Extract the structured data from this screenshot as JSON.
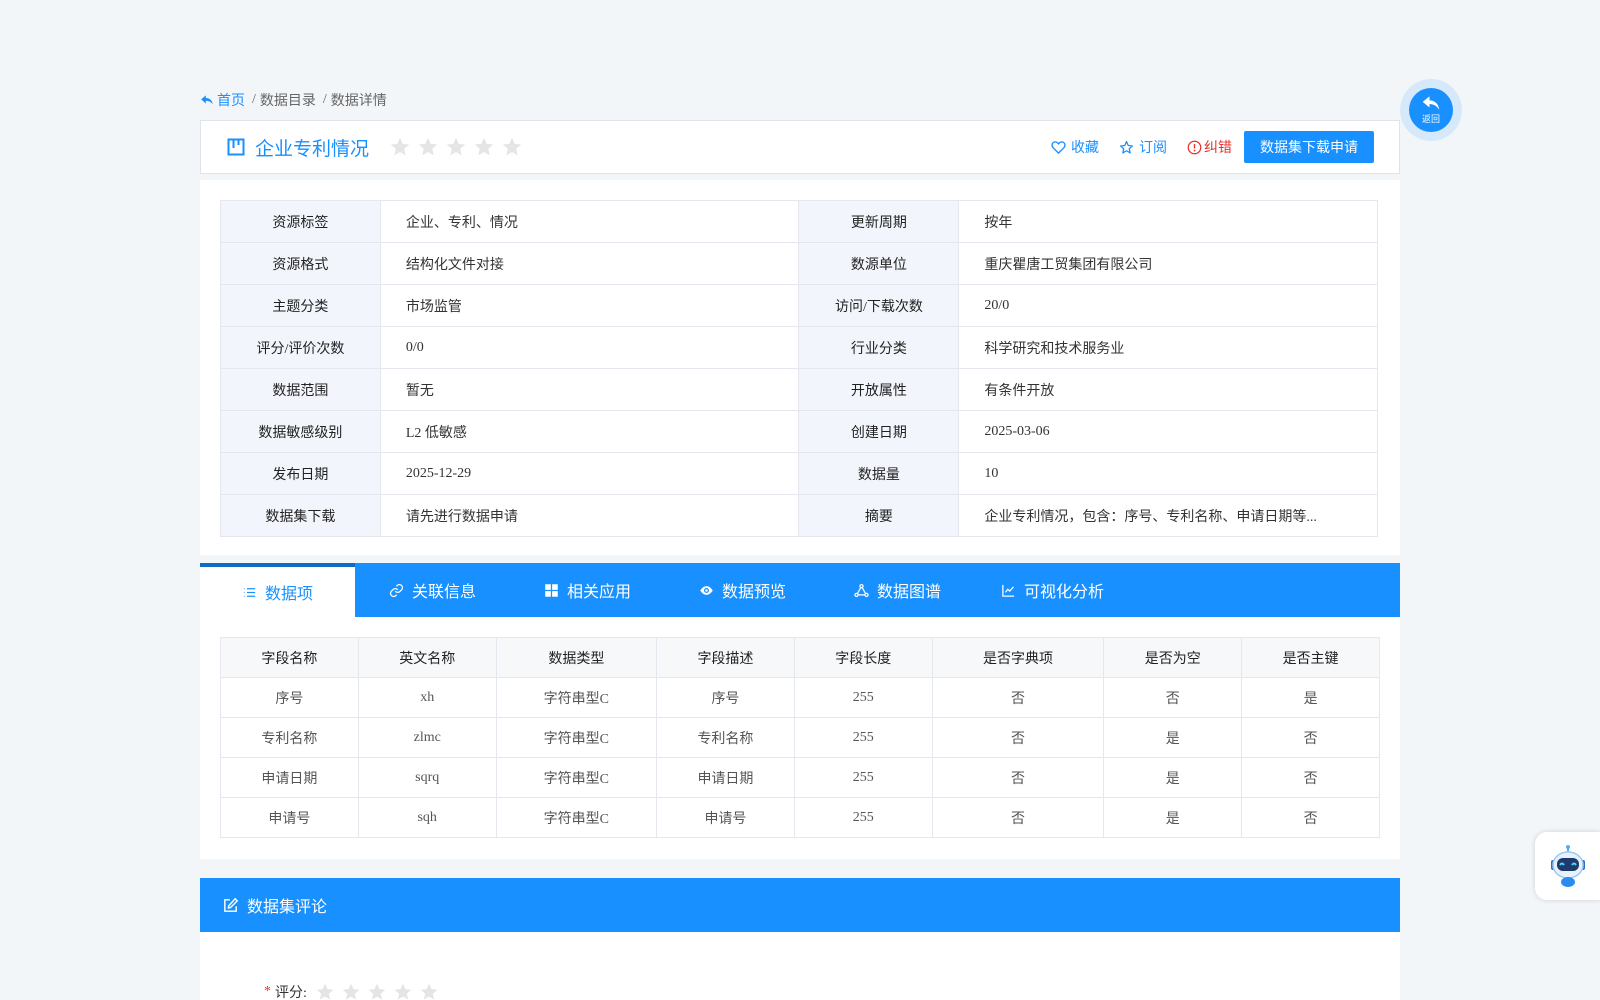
{
  "breadcrumb": {
    "home": "首页",
    "items": [
      "数据目录",
      "数据详情"
    ]
  },
  "title": {
    "name": "企业专利情况",
    "rating_stars": 0,
    "actions": {
      "favorite": "收藏",
      "subscribe": "订阅",
      "report_error": "纠错",
      "apply_button": "数据集下载申请"
    }
  },
  "info": {
    "rows": [
      {
        "l1": "资源标签",
        "v1": "企业、专利、情况",
        "l2": "更新周期",
        "v2": "按年"
      },
      {
        "l1": "资源格式",
        "v1": "结构化文件对接",
        "l2": "数源单位",
        "v2": "重庆瞿唐工贸集团有限公司"
      },
      {
        "l1": "主题分类",
        "v1": "市场监管",
        "l2": "访问/下载次数",
        "v2": "20/0"
      },
      {
        "l1": "评分/评价次数",
        "v1": "0/0",
        "l2": "行业分类",
        "v2": "科学研究和技术服务业"
      },
      {
        "l1": "数据范围",
        "v1": "暂无",
        "l2": "开放属性",
        "v2": "有条件开放"
      },
      {
        "l1": "数据敏感级别",
        "v1": "L2 低敏感",
        "l2": "创建日期",
        "v2": "2025-03-06"
      },
      {
        "l1": "发布日期",
        "v1": "2025-12-29",
        "l2": "数据量",
        "v2": "10"
      },
      {
        "l1": "数据集下载",
        "v1": "请先进行数据申请",
        "l2": "摘要",
        "v2": "企业专利情况，包含：序号、专利名称、申请日期等..."
      }
    ]
  },
  "tabs": {
    "items": [
      {
        "label": "数据项",
        "icon": "list-icon"
      },
      {
        "label": "关联信息",
        "icon": "link-icon"
      },
      {
        "label": "相关应用",
        "icon": "grid-icon"
      },
      {
        "label": "数据预览",
        "icon": "eye-icon"
      },
      {
        "label": "数据图谱",
        "icon": "graph-icon"
      },
      {
        "label": "可视化分析",
        "icon": "line-chart-icon"
      }
    ],
    "active_index": 0
  },
  "fields": {
    "headers": [
      "字段名称",
      "英文名称",
      "数据类型",
      "字段描述",
      "字段长度",
      "是否字典项",
      "是否为空",
      "是否主键"
    ],
    "rows": [
      [
        "序号",
        "xh",
        "字符串型C",
        "序号",
        "255",
        "否",
        "否",
        "是"
      ],
      [
        "专利名称",
        "zlmc",
        "字符串型C",
        "专利名称",
        "255",
        "否",
        "是",
        "否"
      ],
      [
        "申请日期",
        "sqrq",
        "字符串型C",
        "申请日期",
        "255",
        "否",
        "是",
        "否"
      ],
      [
        "申请号",
        "sqh",
        "字符串型C",
        "申请号",
        "255",
        "否",
        "是",
        "否"
      ]
    ]
  },
  "comments": {
    "title": "数据集评论",
    "required_mark": "*",
    "rating_label": "评分:"
  },
  "floating": {
    "back_label": "返回"
  },
  "colors": {
    "primary": "#1890ff",
    "danger": "#e8322b",
    "star_empty": "#e5e5e5"
  }
}
